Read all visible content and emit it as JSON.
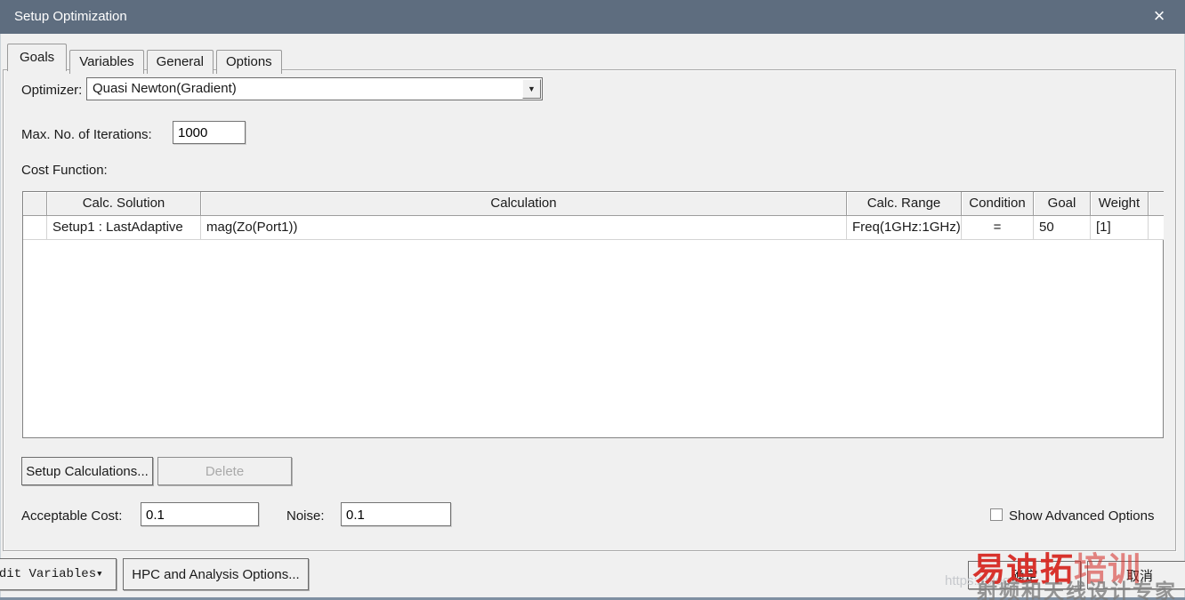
{
  "window": {
    "title": "Setup Optimization"
  },
  "icons": {
    "close": "×",
    "dropdown_arrow": "▼"
  },
  "tabs": [
    {
      "label": "Goals"
    },
    {
      "label": "Variables"
    },
    {
      "label": "General"
    },
    {
      "label": "Options"
    }
  ],
  "goals_tab": {
    "optimizer_label": "Optimizer:",
    "optimizer_value": "Quasi Newton(Gradient)",
    "max_iterations_label": "Max. No. of Iterations:",
    "max_iterations_value": "1000",
    "cost_function_label": "Cost Function:",
    "cost_table": {
      "columns": [
        "",
        "Calc. Solution",
        "Calculation",
        "Calc. Range",
        "Condition",
        "Goal",
        "Weight",
        ""
      ],
      "rows": [
        [
          "",
          "Setup1 : LastAdaptive",
          "mag(Zo(Port1))",
          "Freq(1GHz:1GHz)",
          "=",
          "50",
          "[1]",
          ""
        ]
      ]
    },
    "setup_calculations_button": "Setup Calculations...",
    "delete_button": "Delete",
    "acceptable_cost_label": "Acceptable Cost:",
    "acceptable_cost_value": "0.1",
    "noise_label": "Noise:",
    "noise_value": "0.1",
    "show_advanced_label": "Show Advanced Options",
    "show_advanced_checked": false
  },
  "footer": {
    "edit_variables_button": "Edit Variables",
    "hpc_button": "HPC and Analysis Options...",
    "ok_button": "确定",
    "cancel_button": "取消"
  },
  "watermark": {
    "brand_solid": "易迪拓",
    "brand_faded": "培训",
    "tagline": "射频和天线设计专家",
    "url": "https://blog.cs"
  },
  "colors": {
    "titlebar": "#5e6d7f",
    "watermark_red": "#d62822"
  }
}
